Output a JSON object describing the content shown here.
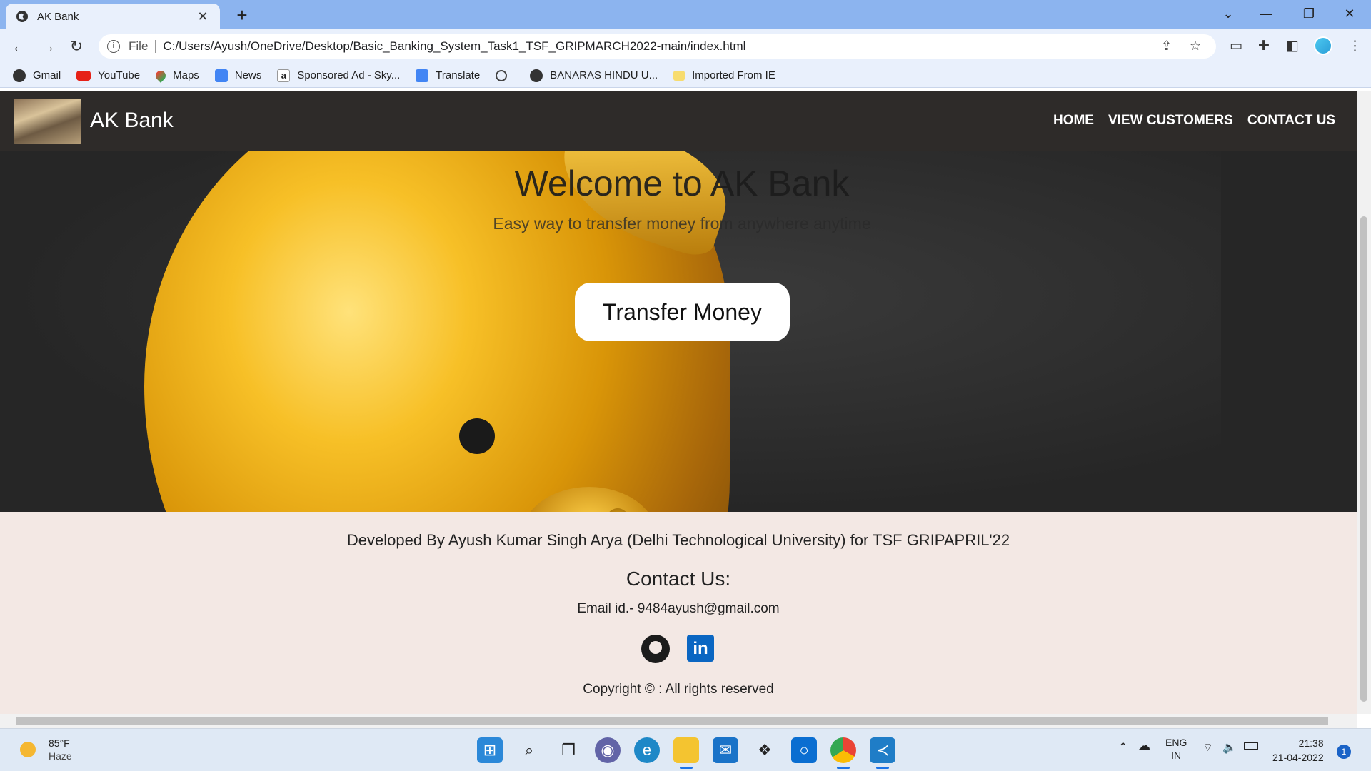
{
  "browser": {
    "tab_title": "AK Bank",
    "tab_close": "✕",
    "new_tab": "+",
    "window_controls": [
      "⌄",
      "—",
      "❐",
      "✕"
    ],
    "nav": {
      "back": "←",
      "forward": "→",
      "reload": "↻"
    },
    "address": {
      "info": "i",
      "scheme": "File",
      "url": "C:/Users/Ayush/OneDrive/Desktop/Basic_Banking_System_Task1_TSF_GRIPMARCH2022-main/index.html"
    },
    "toolbar_icons": [
      "share-icon",
      "star-icon",
      "reading-list-icon",
      "extensions-icon",
      "side-panel-icon",
      "profile-avatar",
      "menu-icon"
    ],
    "bookmarks": [
      {
        "label": "Gmail",
        "icon": "globe-icon",
        "color": "#333333"
      },
      {
        "label": "YouTube",
        "icon": "youtube-icon",
        "color": "#e62117"
      },
      {
        "label": "Maps",
        "icon": "maps-icon",
        "color": "#34a853"
      },
      {
        "label": "News",
        "icon": "news-icon",
        "color": "#4285f4"
      },
      {
        "label": "Sponsored Ad - Sky...",
        "icon": "amazon-icon",
        "color": "#222222"
      },
      {
        "label": "Translate",
        "icon": "translate-icon",
        "color": "#4285f4"
      },
      {
        "label": "",
        "icon": "history-icon",
        "color": "#444444"
      },
      {
        "label": "BANARAS HINDU U...",
        "icon": "globe-icon",
        "color": "#333333"
      },
      {
        "label": "Imported From IE",
        "icon": "folder-icon",
        "color": "#f7dc6f"
      }
    ]
  },
  "page": {
    "brand": "AK Bank",
    "nav_links": [
      "HOME",
      "VIEW CUSTOMERS",
      "CONTACT US"
    ],
    "hero": {
      "title": "Welcome to AK Bank",
      "subtitle": "Easy way to transfer money from anywhere anytime",
      "cta": "Transfer Money"
    },
    "footer": {
      "developed_by": "Developed By Ayush Kumar Singh Arya (Delhi Technological University) for TSF GRIPAPRIL'22",
      "contact_heading": "Contact Us:",
      "email": "Email id.- 9484ayush@gmail.com",
      "social": [
        "github-icon",
        "linkedin-icon"
      ],
      "linkedin_text": "in",
      "copyright": "Copyright © : All rights reserved"
    }
  },
  "taskbar": {
    "weather_temp": "85°F",
    "weather_desc": "Haze",
    "apps": [
      "windows-start-icon",
      "search-icon",
      "task-view-icon",
      "teams-chat-icon",
      "edge-icon",
      "file-explorer-icon",
      "mail-icon",
      "dropbox-icon",
      "cortana-icon",
      "chrome-icon",
      "vscode-icon"
    ],
    "lang_top": "ENG",
    "lang_bottom": "IN",
    "time": "21:38",
    "date": "21-04-2022",
    "notification_count": "1"
  }
}
